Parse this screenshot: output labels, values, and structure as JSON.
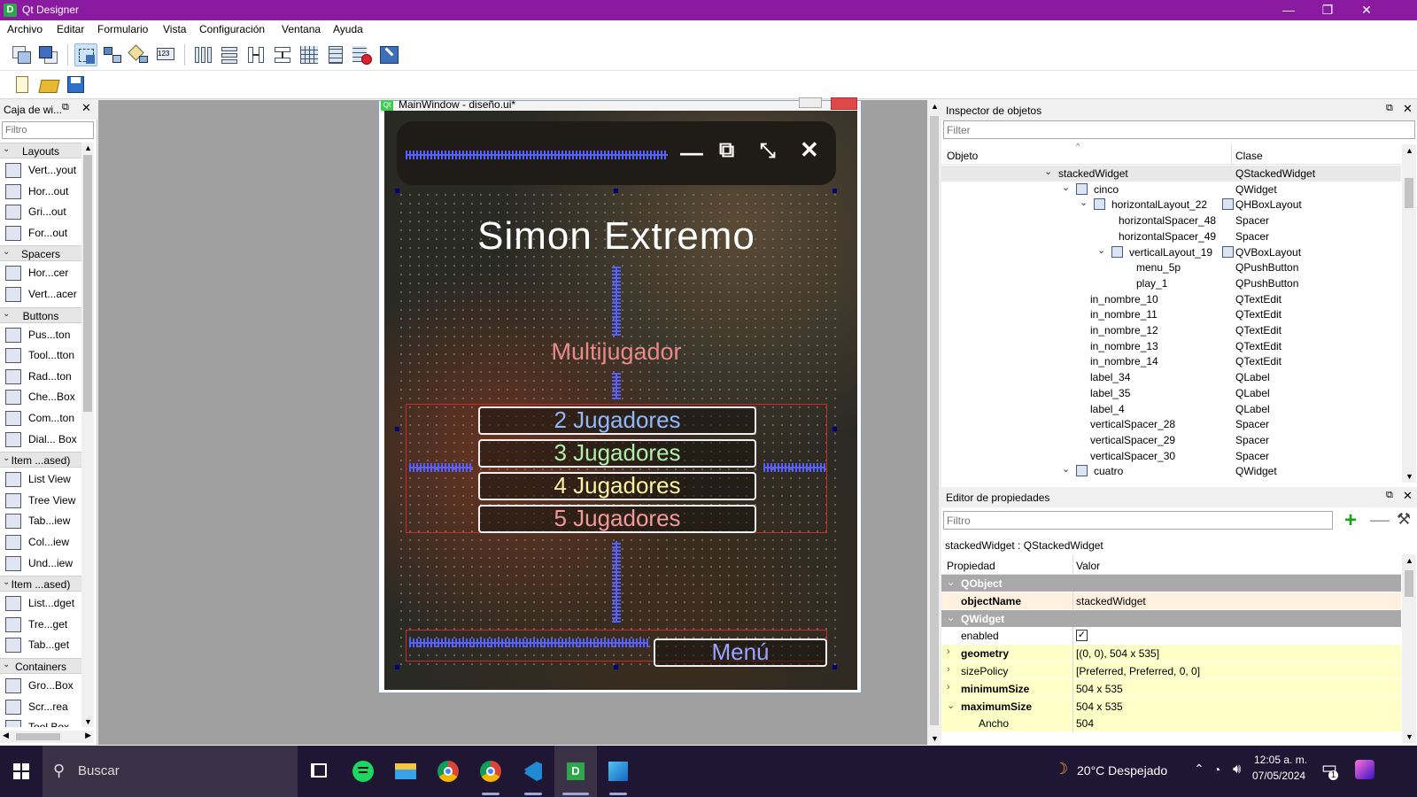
{
  "app": {
    "title": "Qt Designer",
    "icon_letter": "D"
  },
  "window_controls": {
    "minimize": "—",
    "maximize": "❐",
    "close": "✕"
  },
  "menu": [
    "Archivo",
    "Editar",
    "Formulario",
    "Vista",
    "Configuración",
    "Ventana",
    "Ayuda"
  ],
  "widget_box": {
    "title": "Caja de wi...",
    "filter_placeholder": "Filtro",
    "categories": [
      {
        "label": "Layouts",
        "items": [
          "Vert...yout",
          "Hor...out",
          "Gri...out",
          "For...out"
        ]
      },
      {
        "label": "Spacers",
        "items": [
          "Hor...cer",
          "Vert...acer"
        ]
      },
      {
        "label": "Buttons",
        "items": [
          "Pus...ton",
          "Tool...tton",
          "Rad...ton",
          "Che...Box",
          "Com...ton",
          "Dial... Box"
        ]
      },
      {
        "label": "Item ...ased)",
        "items": [
          "List View",
          "Tree View",
          "Tab...iew",
          "Col...iew",
          "Und...iew"
        ]
      },
      {
        "label": "Item ...ased)",
        "items": [
          "List...dget",
          "Tre...get",
          "Tab...get"
        ]
      },
      {
        "label": "Containers",
        "items": [
          "Gro...Box",
          "Scr...rea",
          "Tool Box"
        ]
      }
    ]
  },
  "form": {
    "window_title": "MainWindow - diseño.ui*",
    "heading": "Simon Extremo",
    "subtitle": "Multijugador",
    "player_buttons": [
      {
        "label": "2 Jugadores",
        "color": "#8fb8ff"
      },
      {
        "label": "3 Jugadores",
        "color": "#aef0a8"
      },
      {
        "label": "4 Jugadores",
        "color": "#fff3a0"
      },
      {
        "label": "5 Jugadores",
        "color": "#f29a98"
      }
    ],
    "menu_button": "Menú",
    "control_icons": {
      "minimize": "minus-icon",
      "popout": "external-link-icon",
      "shrink": "collapse-icon",
      "close": "close-icon"
    }
  },
  "inspector": {
    "title": "Inspector de objetos",
    "filter_placeholder": "Filter",
    "col_object": "Objeto",
    "col_class": "Clase",
    "rows": [
      {
        "name": "stackedWidget",
        "cls": "QStackedWidget",
        "depth": 0,
        "expander": "⌄",
        "icon": ""
      },
      {
        "name": "cinco",
        "cls": "QWidget",
        "depth": 1,
        "expander": "⌄",
        "icon": "vbox"
      },
      {
        "name": "horizontalLayout_22",
        "cls": "QHBoxLayout",
        "depth": 2,
        "expander": "⌄",
        "icon": "hbox"
      },
      {
        "name": "horizontalSpacer_48",
        "cls": "Spacer",
        "depth": 3,
        "expander": "",
        "icon": ""
      },
      {
        "name": "horizontalSpacer_49",
        "cls": "Spacer",
        "depth": 3,
        "expander": "",
        "icon": ""
      },
      {
        "name": "verticalLayout_19",
        "cls": "QVBoxLayout",
        "depth": 3,
        "expander": "⌄",
        "icon": "vbox"
      },
      {
        "name": "menu_5p",
        "cls": "QPushButton",
        "depth": 4,
        "expander": "",
        "icon": ""
      },
      {
        "name": "play_1",
        "cls": "QPushButton",
        "depth": 4,
        "expander": "",
        "icon": ""
      },
      {
        "name": "in_nombre_10",
        "cls": "QTextEdit",
        "depth": 2,
        "expander": "",
        "icon": ""
      },
      {
        "name": "in_nombre_11",
        "cls": "QTextEdit",
        "depth": 2,
        "expander": "",
        "icon": ""
      },
      {
        "name": "in_nombre_12",
        "cls": "QTextEdit",
        "depth": 2,
        "expander": "",
        "icon": ""
      },
      {
        "name": "in_nombre_13",
        "cls": "QTextEdit",
        "depth": 2,
        "expander": "",
        "icon": ""
      },
      {
        "name": "in_nombre_14",
        "cls": "QTextEdit",
        "depth": 2,
        "expander": "",
        "icon": ""
      },
      {
        "name": "label_34",
        "cls": "QLabel",
        "depth": 2,
        "expander": "",
        "icon": ""
      },
      {
        "name": "label_35",
        "cls": "QLabel",
        "depth": 2,
        "expander": "",
        "icon": ""
      },
      {
        "name": "label_4",
        "cls": "QLabel",
        "depth": 2,
        "expander": "",
        "icon": ""
      },
      {
        "name": "verticalSpacer_28",
        "cls": "Spacer",
        "depth": 2,
        "expander": "",
        "icon": ""
      },
      {
        "name": "verticalSpacer_29",
        "cls": "Spacer",
        "depth": 2,
        "expander": "",
        "icon": ""
      },
      {
        "name": "verticalSpacer_30",
        "cls": "Spacer",
        "depth": 2,
        "expander": "",
        "icon": ""
      },
      {
        "name": "cuatro",
        "cls": "QWidget",
        "depth": 1,
        "expander": "⌄",
        "icon": "vbox"
      }
    ]
  },
  "property_editor": {
    "title": "Editor de propiedades",
    "filter_placeholder": "Filtro",
    "context": "stackedWidget : QStackedWidget",
    "col_property": "Propiedad",
    "col_value": "Valor",
    "rows": [
      {
        "type": "cat",
        "name": "QObject"
      },
      {
        "type": "prop",
        "name": "objectName",
        "value": "stackedWidget",
        "bold": true,
        "bg": "orange"
      },
      {
        "type": "cat",
        "name": "QWidget"
      },
      {
        "type": "check",
        "name": "enabled",
        "value": "✓",
        "bold": false,
        "bg": "white"
      },
      {
        "type": "prop",
        "name": "geometry",
        "value": "[(0, 0), 504 x 535]",
        "bold": true,
        "bg": "yellow",
        "exp": "›"
      },
      {
        "type": "prop",
        "name": "sizePolicy",
        "value": "[Preferred, Preferred, 0, 0]",
        "bold": false,
        "bg": "yellow",
        "exp": "›"
      },
      {
        "type": "prop",
        "name": "minimumSize",
        "value": "504 x 535",
        "bold": true,
        "bg": "yellow",
        "exp": "›"
      },
      {
        "type": "prop",
        "name": "maximumSize",
        "value": "504 x 535",
        "bold": true,
        "bg": "yellow",
        "exp": "⌄"
      },
      {
        "type": "prop",
        "name": "Ancho",
        "value": "504",
        "bold": false,
        "bg": "yellow",
        "indent": true
      }
    ]
  },
  "taskbar": {
    "search_placeholder": "Buscar",
    "weather": "20°C  Despejado",
    "time": "12:05 a. m.",
    "date": "07/05/2024",
    "notification_count": "1",
    "apps": [
      "task-view-icon",
      "spotify-icon",
      "file-explorer-icon",
      "chrome-icon",
      "chrome-profile-icon",
      "vscode-icon",
      "qt-designer-icon",
      "photos-icon"
    ]
  }
}
